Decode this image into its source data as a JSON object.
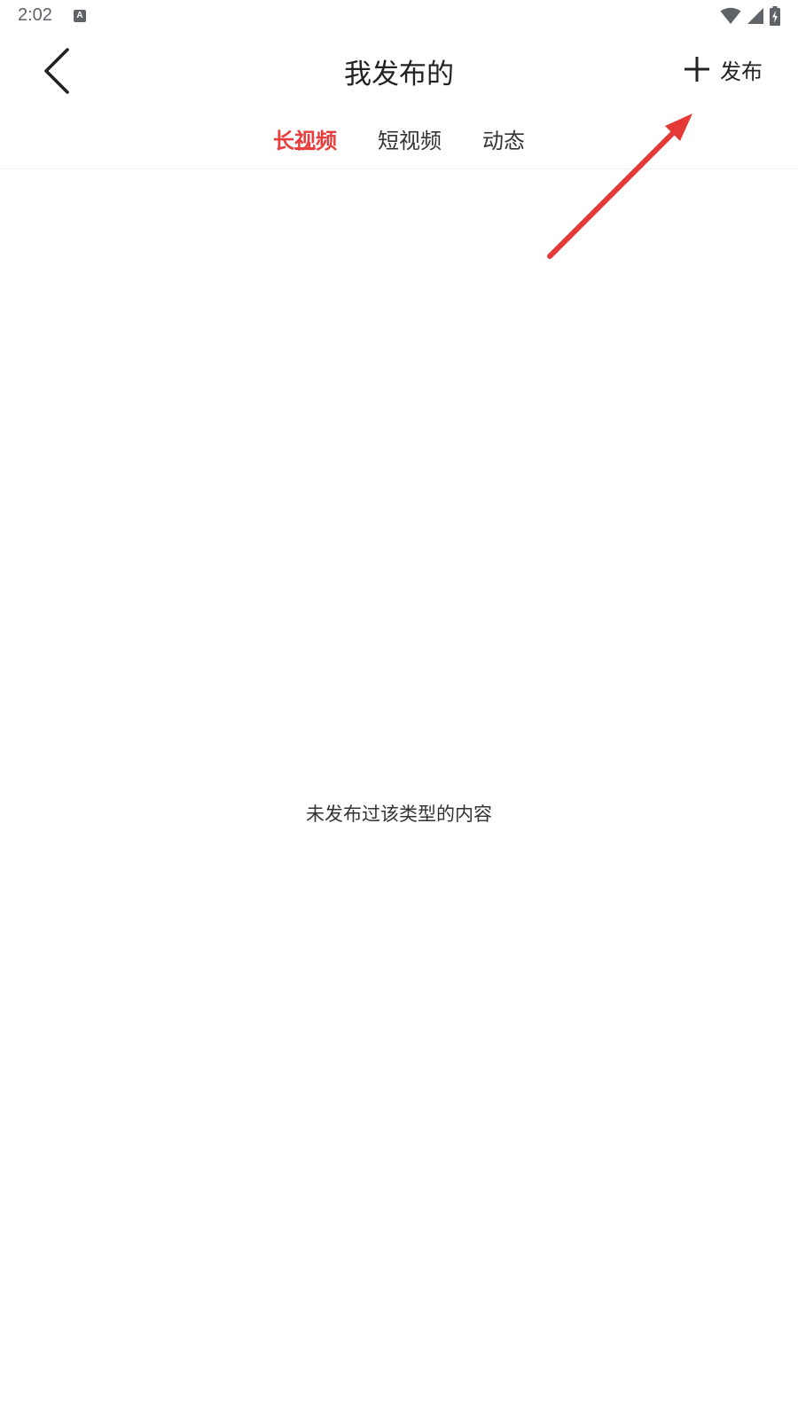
{
  "status_bar": {
    "time": "2:02",
    "notification_icon": "A"
  },
  "header": {
    "title": "我发布的",
    "back_icon": "chevron-left-icon",
    "publish_label": "发布",
    "publish_icon": "plus-icon"
  },
  "tabs": [
    {
      "label": "长视频",
      "active": true
    },
    {
      "label": "短视频",
      "active": false
    },
    {
      "label": "动态",
      "active": false
    }
  ],
  "empty_state": {
    "message": "未发布过该类型的内容"
  },
  "colors": {
    "accent": "#e83e3e",
    "annotation": "#e53935"
  }
}
